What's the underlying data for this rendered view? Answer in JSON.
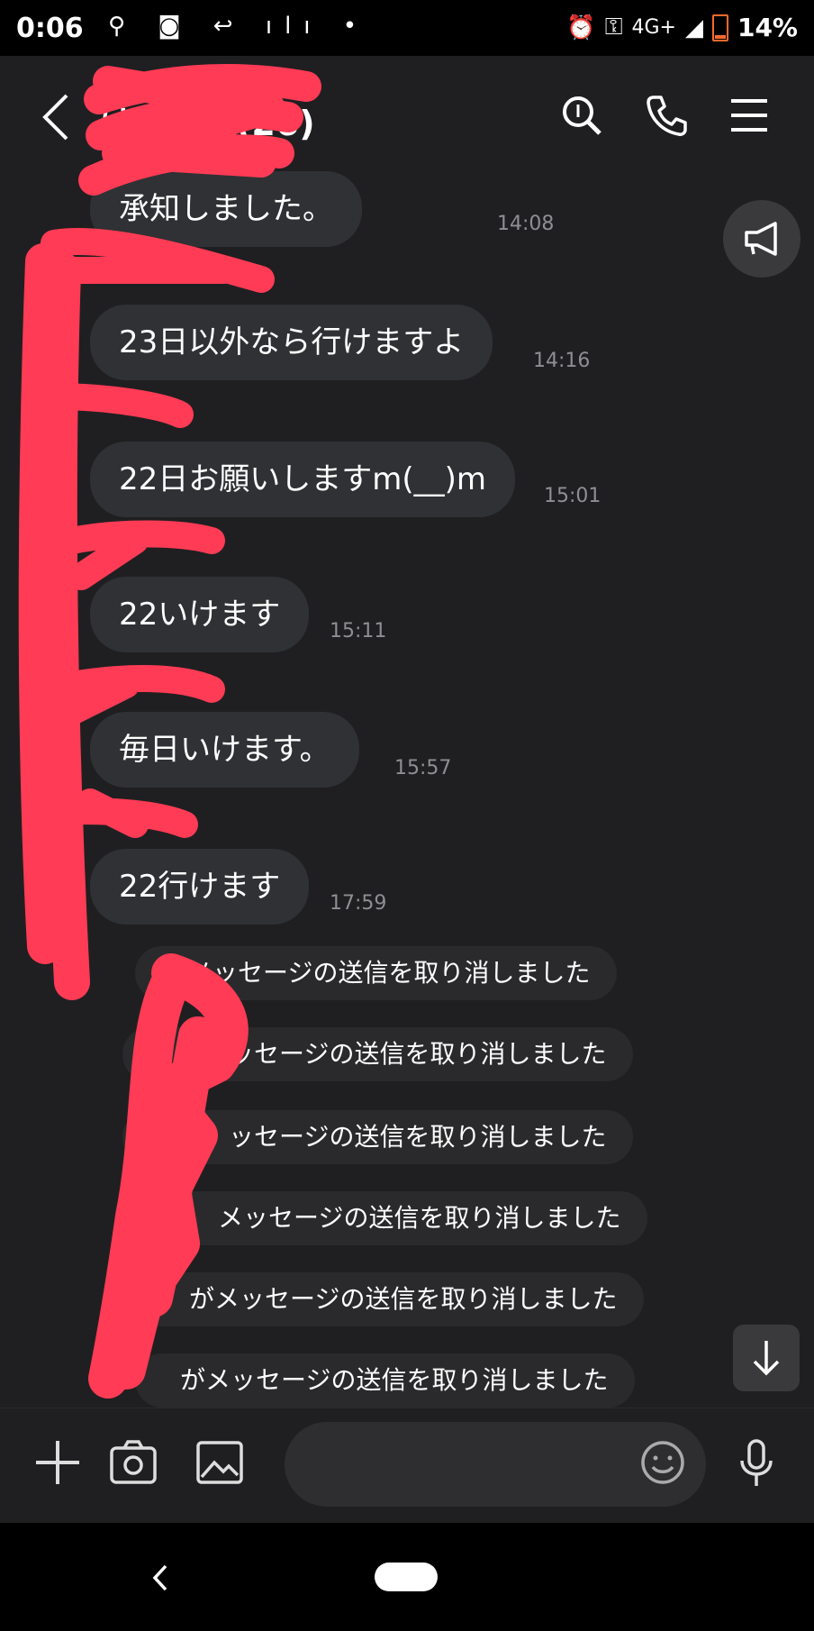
{
  "status_bar": {
    "time": "0:06",
    "network": "4G+",
    "battery": "14%"
  },
  "header": {
    "title": "は愛好家(26)",
    "icons": [
      "back-icon",
      "search-icon",
      "phone-icon",
      "menu-icon"
    ]
  },
  "messages": [
    {
      "text": "承知しました。",
      "time": "14:08"
    },
    {
      "text": "23日以外なら行けますよ",
      "time": "14:16"
    },
    {
      "text": "22日お願いしますm(__)m",
      "time": "15:01"
    },
    {
      "text": "22いけます",
      "time": "15:11"
    },
    {
      "text": "毎日いけます。",
      "time": "15:57"
    },
    {
      "text": "22行けます",
      "time": "17:59"
    }
  ],
  "notices": [
    "がメッセージの送信を取り消しました",
    "ッセージの送信を取り消しました",
    "ッセージの送信を取り消しました",
    "メッセージの送信を取り消しました",
    "がメッセージの送信を取り消しました",
    "がメッセージの送信を取り消しました"
  ],
  "input": {
    "placeholder": ""
  },
  "colors": {
    "background": "#1f1f21",
    "bubble": "#303134",
    "timestamp": "#8e8e93",
    "redaction": "#ff3b55"
  }
}
